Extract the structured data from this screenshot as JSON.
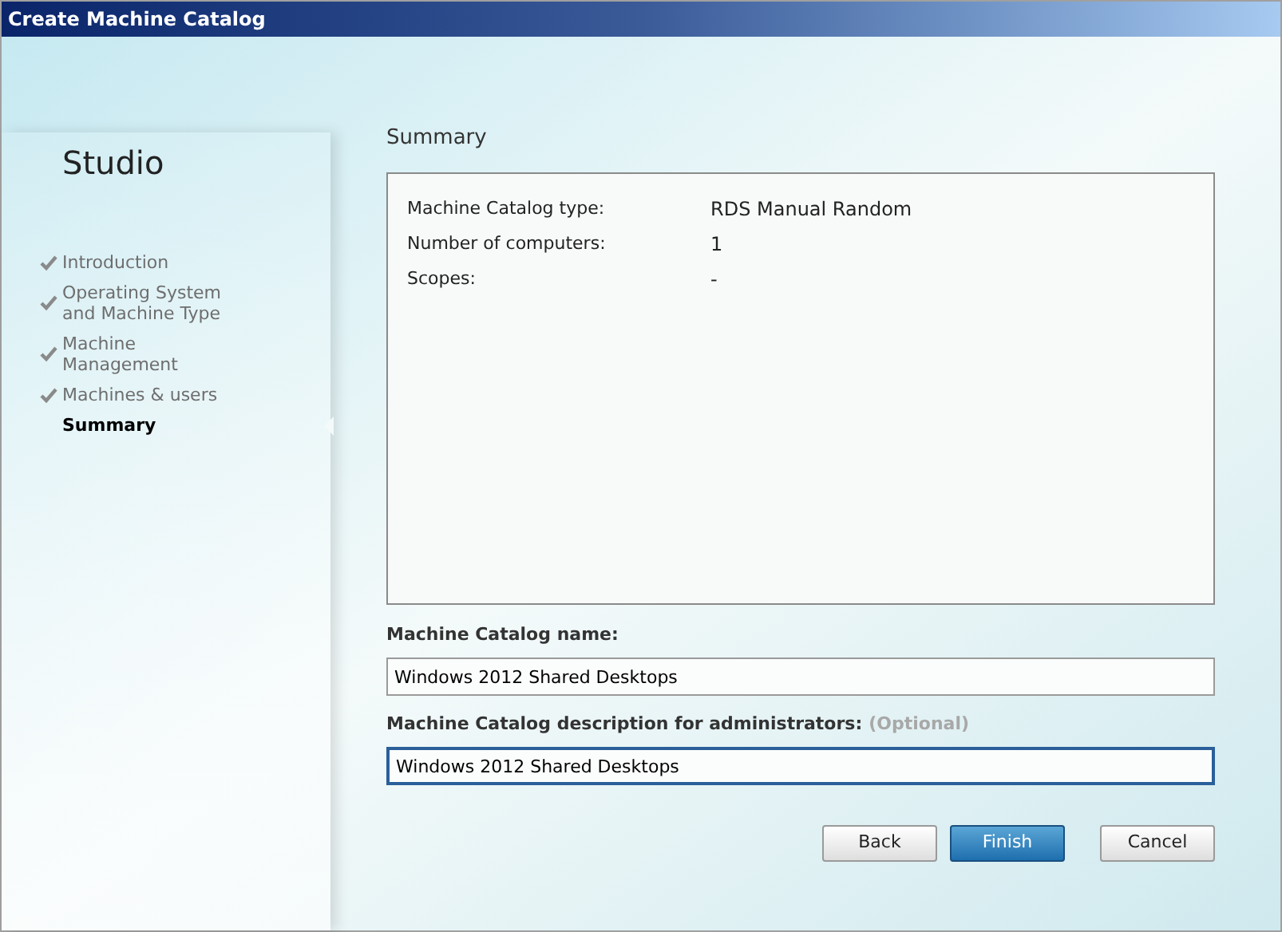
{
  "window": {
    "title": "Create Machine Catalog"
  },
  "sidebar": {
    "title": "Studio",
    "steps": [
      {
        "label": "Introduction",
        "completed": true,
        "selected": false
      },
      {
        "label": "Operating System and Machine Type",
        "completed": true,
        "selected": false
      },
      {
        "label": "Machine Management",
        "completed": true,
        "selected": false
      },
      {
        "label": "Machines & users",
        "completed": true,
        "selected": false
      },
      {
        "label": "Summary",
        "completed": false,
        "selected": true
      }
    ]
  },
  "page": {
    "title": "Summary",
    "summary": [
      {
        "label": "Machine Catalog type:",
        "value": "RDS Manual Random"
      },
      {
        "label": "Number of computers:",
        "value": "1"
      },
      {
        "label": "Scopes:",
        "value": "-"
      }
    ],
    "fields": [
      {
        "label": "Machine Catalog name:",
        "value": "Windows 2012 Shared Desktops",
        "focused": false
      },
      {
        "label": "Machine Catalog description for administrators:",
        "hint": "(Optional)",
        "value": "Windows 2012 Shared Desktops",
        "focused": true
      }
    ]
  },
  "buttons": [
    {
      "label": "Back",
      "kind": "secondary"
    },
    {
      "label": "Finish",
      "kind": "primary"
    },
    {
      "label": "Cancel",
      "kind": "secondary"
    }
  ]
}
